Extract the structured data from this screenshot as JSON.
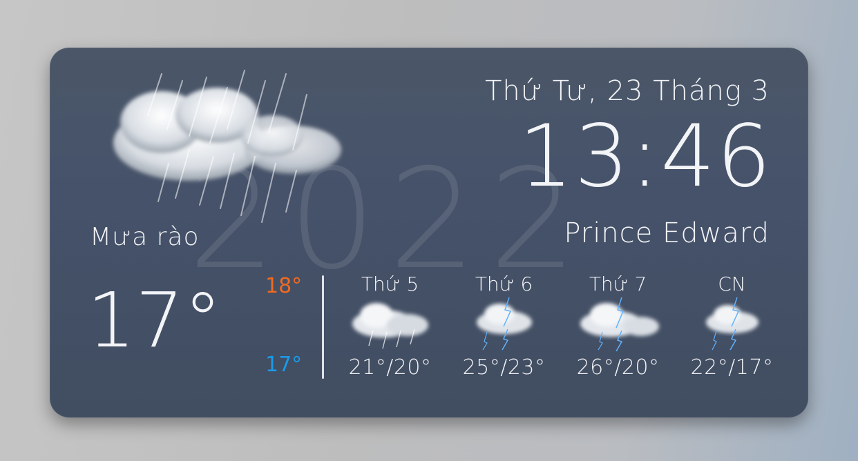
{
  "widget": {
    "year_watermark": "2022",
    "condition": "Mưa rào",
    "condition_icon": "rain-cloud-icon",
    "date": "Thứ Tư, 23 Tháng 3",
    "time": "13:46",
    "location": "Prince Edward",
    "current_temp": "17°",
    "high_temp": "18°",
    "low_temp": "17°",
    "high_color": "#f06a1f",
    "low_color": "#1b9ae8"
  },
  "forecast": [
    {
      "day": "Thứ 5",
      "temps": "21°/20°",
      "icon": "rain-cloud-icon"
    },
    {
      "day": "Thứ 6",
      "temps": "25°/23°",
      "icon": "thunderstorm-icon"
    },
    {
      "day": "Thứ 7",
      "temps": "26°/20°",
      "icon": "thunderstorm-icon"
    },
    {
      "day": "CN",
      "temps": "22°/17°",
      "icon": "thunderstorm-icon"
    }
  ]
}
